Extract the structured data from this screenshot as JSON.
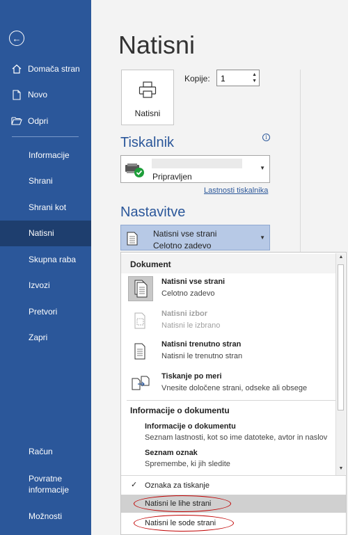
{
  "sidebar": {
    "back_icon": "back-arrow-icon",
    "top_items": [
      {
        "label": "Domača stran",
        "icon": "home-icon"
      },
      {
        "label": "Novo",
        "icon": "new-document-icon"
      },
      {
        "label": "Odpri",
        "icon": "open-folder-icon"
      }
    ],
    "mid_items": [
      {
        "label": "Informacije"
      },
      {
        "label": "Shrani"
      },
      {
        "label": "Shrani kot"
      },
      {
        "label": "Natisni",
        "active": true
      },
      {
        "label": "Skupna raba"
      },
      {
        "label": "Izvozi"
      },
      {
        "label": "Pretvori"
      },
      {
        "label": "Zapri"
      }
    ],
    "bottom_items": [
      {
        "label": "Račun"
      },
      {
        "label": "Povratne informacije"
      },
      {
        "label": "Možnosti"
      }
    ],
    "bottom_feedback_line1": "Povratne",
    "bottom_feedback_line2": "informacije",
    "bg_color": "#2b579a"
  },
  "main": {
    "title": "Natisni",
    "print_button_label": "Natisni",
    "copies_label": "Kopije:",
    "copies_value": "1",
    "printer_heading": "Tiskalnik",
    "printer_status": "Pripravljen",
    "printer_properties_link": "Lastnosti tiskalnika",
    "settings_heading": "Nastavitve",
    "settings_selected_line1": "Natisni vse strani",
    "settings_selected_line2": "Celotno zadevo"
  },
  "dropdown": {
    "group1_header": "Dokument",
    "options": [
      {
        "title": "Natisni vse strani",
        "subtitle": "Celotno zadevo",
        "selected": true,
        "disabled": false
      },
      {
        "title": "Natisni izbor",
        "subtitle": "Natisni le izbrano",
        "selected": false,
        "disabled": true
      },
      {
        "title": "Natisni trenutno stran",
        "subtitle": "Natisni le trenutno stran",
        "selected": false,
        "disabled": false
      },
      {
        "title": "Tiskanje po meri",
        "subtitle": "Vnesite določene strani, odseke ali obsege",
        "selected": false,
        "disabled": false
      }
    ],
    "group2_header": "Informacije o dokumentu",
    "info_options": [
      {
        "title": "Informacije o dokumentu",
        "subtitle": "Seznam lastnosti, kot so ime datoteke, avtor in naslov"
      },
      {
        "title": "Seznam oznak",
        "subtitle": "Spremembe, ki jih sledite"
      }
    ],
    "markup_option": "Oznaka za tiskanje",
    "odd_pages_option": "Natisni le lihe strani",
    "even_pages_option": "Natisni le sode strani",
    "highlight_color": "#c00000"
  }
}
